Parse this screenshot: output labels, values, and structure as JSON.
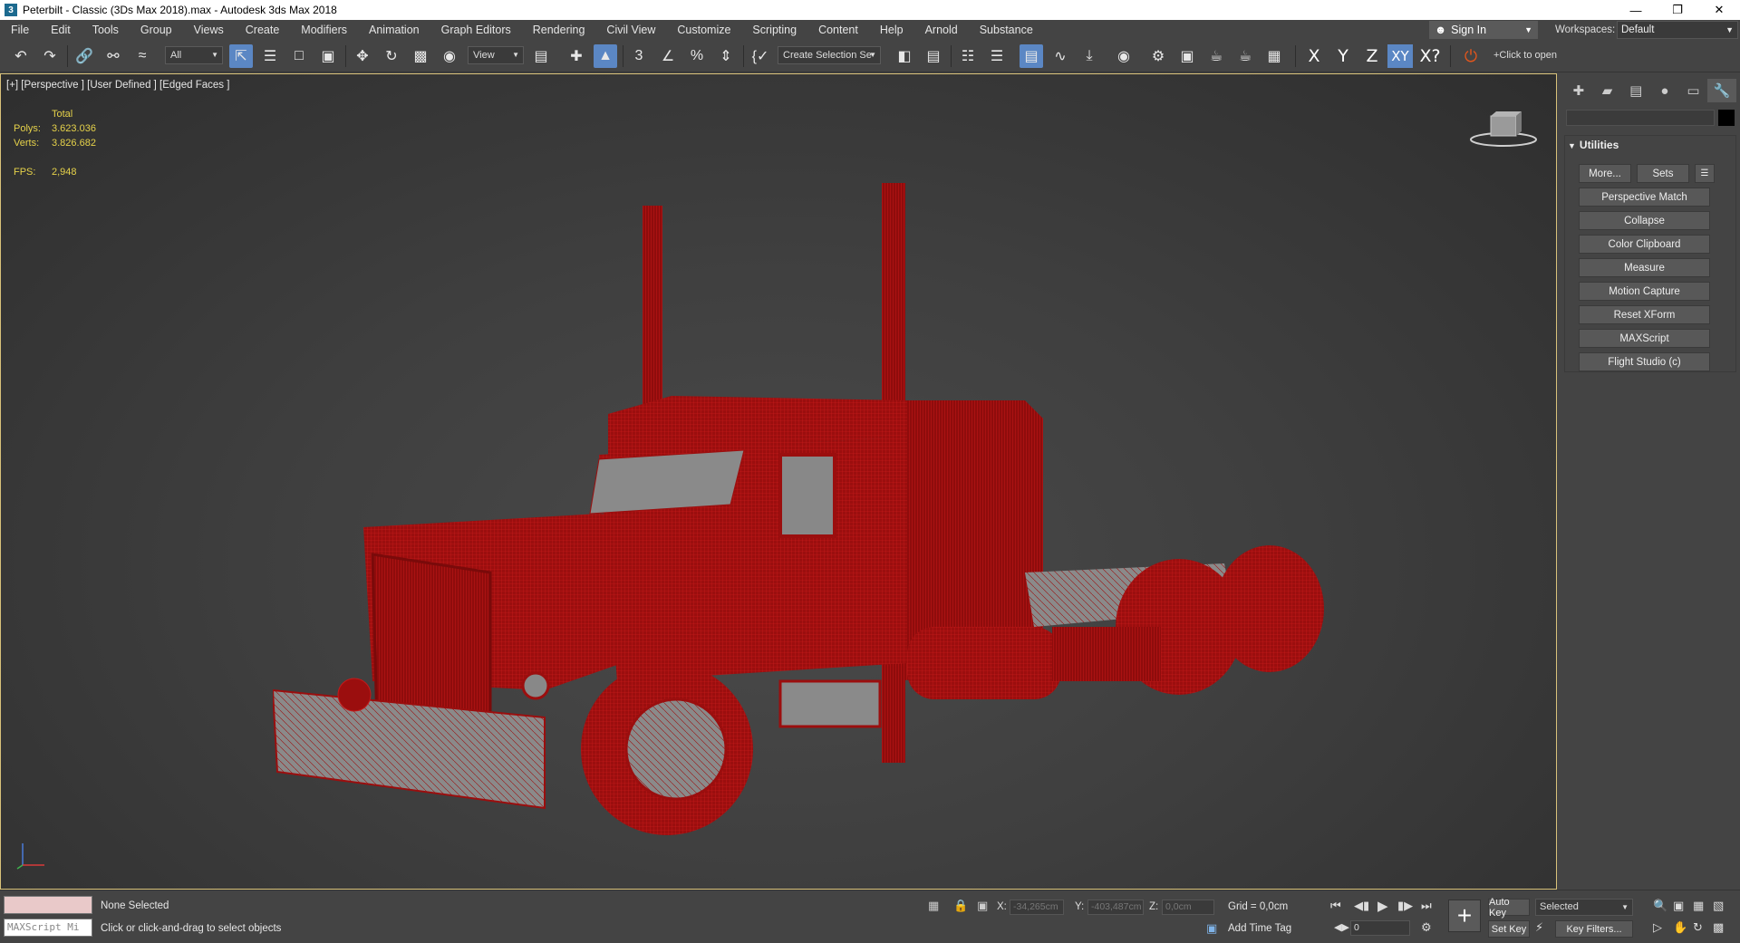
{
  "window": {
    "title": "Peterbilt - Classic (3Ds Max 2018).max - Autodesk 3ds Max 2018",
    "app_icon": "3",
    "min": "—",
    "max": "❐",
    "close": "✕"
  },
  "menu": [
    "File",
    "Edit",
    "Tools",
    "Group",
    "Views",
    "Create",
    "Modifiers",
    "Animation",
    "Graph Editors",
    "Rendering",
    "Civil View",
    "Customize",
    "Scripting",
    "Content",
    "Help",
    "Arnold",
    "Substance"
  ],
  "account": {
    "signin": "Sign In",
    "workspaces_label": "Workspaces:",
    "workspace": "Default"
  },
  "toolbar": {
    "filter": "All",
    "ref_coord": "View",
    "selection_set": "Create Selection Se",
    "axis_x": "X",
    "axis_y": "Y",
    "axis_z": "Z",
    "axis_xy": "XY",
    "axis_xq": "X?",
    "click_to_open": "+Click to open"
  },
  "viewport": {
    "label": "[+] [Perspective ] [User Defined ] [Edged Faces ]",
    "stats": {
      "header": "Total",
      "polys_label": "Polys:",
      "polys": "3.623.036",
      "verts_label": "Verts:",
      "verts": "3.826.682",
      "fps_label": "FPS:",
      "fps": "2,948"
    },
    "model_color": "#9b0e0e",
    "edge_color": "#c51a1a",
    "body_gray": "#8a8a8a"
  },
  "command_panel": {
    "rollout": "Utilities",
    "more": "More...",
    "sets": "Sets",
    "utilities": [
      "Perspective Match",
      "Collapse",
      "Color Clipboard",
      "Measure",
      "Motion Capture",
      "Reset XForm",
      "MAXScript",
      "Flight Studio (c)"
    ]
  },
  "status": {
    "maxscript_placeholder": "MAXScript Mi",
    "selection": "None Selected",
    "prompt": "Click or click-and-drag to select objects",
    "x_label": "X:",
    "x": "-34,265cm",
    "y_label": "Y:",
    "y": "-403,487cm",
    "z_label": "Z:",
    "z": "0,0cm",
    "grid": "Grid = 0,0cm",
    "add_time_tag": "Add Time Tag",
    "auto_key": "Auto Key",
    "set_key": "Set Key",
    "key_mode": "Selected",
    "key_filters": "Key Filters...",
    "frame": "0"
  }
}
